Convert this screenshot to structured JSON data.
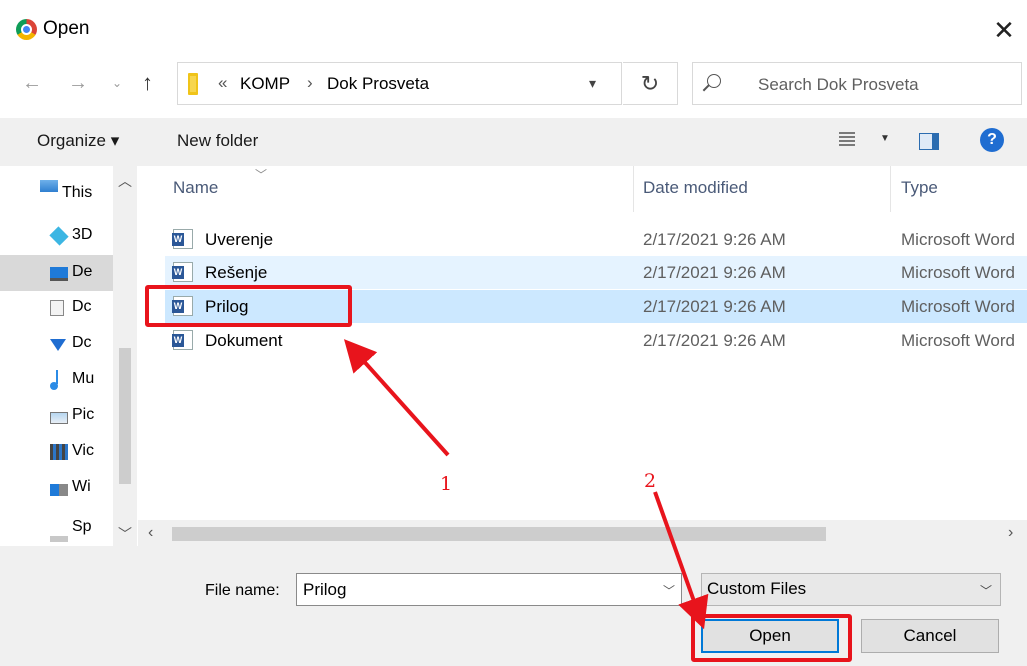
{
  "window": {
    "title": "Open"
  },
  "address": {
    "overflow": "«",
    "crumbs": [
      "KOMP",
      "Dok Prosveta"
    ],
    "separator": "›"
  },
  "search": {
    "placeholder": "Search Dok Prosveta"
  },
  "toolbar": {
    "organize": "Organize ▾",
    "new_folder": "New folder",
    "help": "?"
  },
  "nav": {
    "items": [
      {
        "label": "This",
        "icon": "pc-icon"
      },
      {
        "label": "3D",
        "icon": "3d-objects-icon"
      },
      {
        "label": "De",
        "icon": "desktop-icon",
        "selected": true
      },
      {
        "label": "Dc",
        "icon": "documents-icon"
      },
      {
        "label": "Dc",
        "icon": "downloads-icon"
      },
      {
        "label": "Mu",
        "icon": "music-icon"
      },
      {
        "label": "Pic",
        "icon": "pictures-icon"
      },
      {
        "label": "Vic",
        "icon": "videos-icon"
      },
      {
        "label": "Wi",
        "icon": "windows-drive-icon"
      },
      {
        "label": "Sp",
        "icon": "drive-icon"
      }
    ]
  },
  "columns": {
    "name": "Name",
    "date": "Date modified",
    "type": "Type"
  },
  "files": [
    {
      "name": "Uverenje",
      "date": "2/17/2021 9:26 AM",
      "type": "Microsoft Word",
      "state": "normal"
    },
    {
      "name": "Rešenje",
      "date": "2/17/2021 9:26 AM",
      "type": "Microsoft Word",
      "state": "hover"
    },
    {
      "name": "Prilog",
      "date": "2/17/2021 9:26 AM",
      "type": "Microsoft Word",
      "state": "selected"
    },
    {
      "name": "Dokument",
      "date": "2/17/2021 9:26 AM",
      "type": "Microsoft Word",
      "state": "normal"
    }
  ],
  "bottom": {
    "filename_label": "File name:",
    "filename_value": "Prilog",
    "filetype_value": "Custom Files",
    "open_label": "Open",
    "cancel_label": "Cancel"
  },
  "annotations": {
    "step1": "1",
    "step2": "2",
    "color": "#e8141c"
  },
  "colors": {
    "selected_row": "#cce8ff",
    "hover_row": "#e5f3ff",
    "accent": "#0078d7"
  }
}
